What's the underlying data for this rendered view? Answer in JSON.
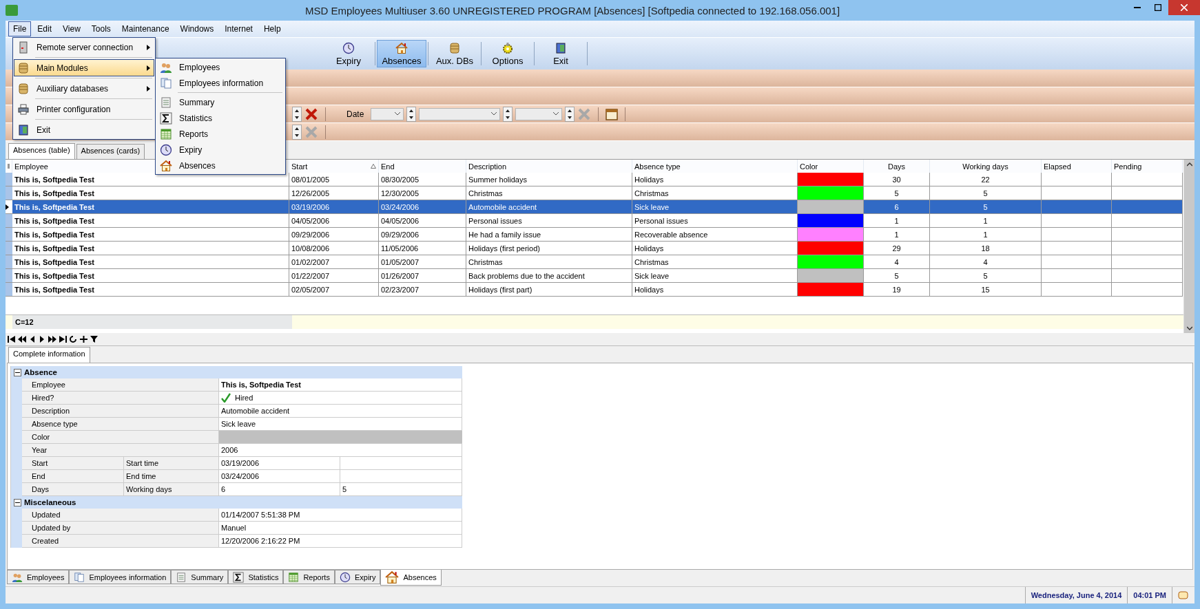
{
  "window": {
    "title": "MSD Employees Multiuser 3.60 UNREGISTERED PROGRAM [Absences] [Softpedia connected to 192.168.056.001]"
  },
  "menu_bar": [
    {
      "label": "File",
      "selected": true
    },
    {
      "label": "Edit",
      "selected": false
    },
    {
      "label": "View",
      "selected": false
    },
    {
      "label": "Tools",
      "selected": false
    },
    {
      "label": "Maintenance",
      "selected": false
    },
    {
      "label": "Windows",
      "selected": false
    },
    {
      "label": "Internet",
      "selected": false
    },
    {
      "label": "Help",
      "selected": false
    }
  ],
  "file_menu": [
    {
      "label": "Remote server connection",
      "has_submenu": true,
      "selected": false
    },
    {
      "label": "Main Modules",
      "has_submenu": true,
      "selected": true
    },
    {
      "label": "Auxiliary databases",
      "has_submenu": true,
      "selected": false
    },
    {
      "label": "Printer configuration",
      "has_submenu": false,
      "selected": false
    },
    {
      "label": "Exit",
      "has_submenu": false,
      "selected": false
    }
  ],
  "submenu": [
    {
      "label": "Employees",
      "separator_after": false
    },
    {
      "label": "Employees information",
      "separator_after": true
    },
    {
      "label": "Summary",
      "separator_after": false
    },
    {
      "label": "Statistics",
      "separator_after": false
    },
    {
      "label": "Reports",
      "separator_after": false
    },
    {
      "label": "Expiry",
      "separator_after": false
    },
    {
      "label": "Absences",
      "separator_after": false
    }
  ],
  "toolbar": [
    {
      "label": "Expiry",
      "selected": false
    },
    {
      "label": "Absences",
      "selected": true
    },
    {
      "label": "Aux. DBs",
      "selected": false
    },
    {
      "label": "Options",
      "selected": false
    },
    {
      "label": "Exit",
      "selected": false
    }
  ],
  "filters": {
    "date_label": "Date"
  },
  "view_tabs": [
    {
      "label": "Absences (table)",
      "selected": true
    },
    {
      "label": "Absences (cards)",
      "selected": false
    }
  ],
  "table": {
    "columns": [
      {
        "label": "Employee",
        "sorted": false
      },
      {
        "label": "Start",
        "sorted": true
      },
      {
        "label": "End",
        "sorted": false
      },
      {
        "label": "Description",
        "sorted": false
      },
      {
        "label": "Absence type",
        "sorted": false
      },
      {
        "label": "Color",
        "sorted": false
      },
      {
        "label": "Days",
        "sorted": false
      },
      {
        "label": "Working days",
        "sorted": false
      },
      {
        "label": "Elapsed",
        "sorted": false
      },
      {
        "label": "Pending",
        "sorted": false
      }
    ],
    "rows": [
      {
        "employee": "This is, Softpedia Test",
        "start": "08/01/2005",
        "end": "08/30/2005",
        "description": "Summer holidays",
        "absence_type": "Holidays",
        "color": "#ff0000",
        "days": "30",
        "working_days": "22",
        "selected": false
      },
      {
        "employee": "This is, Softpedia Test",
        "start": "12/26/2005",
        "end": "12/30/2005",
        "description": "Christmas",
        "absence_type": "Christmas",
        "color": "#00ff00",
        "days": "5",
        "working_days": "5",
        "selected": false
      },
      {
        "employee": "This is, Softpedia Test",
        "start": "03/19/2006",
        "end": "03/24/2006",
        "description": "Automobile accident",
        "absence_type": "Sick leave",
        "color": "#c0c0c0",
        "days": "6",
        "working_days": "5",
        "selected": true
      },
      {
        "employee": "This is, Softpedia Test",
        "start": "04/05/2006",
        "end": "04/05/2006",
        "description": "Personal issues",
        "absence_type": "Personal issues",
        "color": "#0000ff",
        "days": "1",
        "working_days": "1",
        "selected": false
      },
      {
        "employee": "This is, Softpedia Test",
        "start": "09/29/2006",
        "end": "09/29/2006",
        "description": "He had a family issue",
        "absence_type": "Recoverable absence",
        "color": "#ff80ff",
        "days": "1",
        "working_days": "1",
        "selected": false
      },
      {
        "employee": "This is, Softpedia Test",
        "start": "10/08/2006",
        "end": "11/05/2006",
        "description": "Holidays (first period)",
        "absence_type": "Holidays",
        "color": "#ff0000",
        "days": "29",
        "working_days": "18",
        "selected": false
      },
      {
        "employee": "This is, Softpedia Test",
        "start": "01/02/2007",
        "end": "01/05/2007",
        "description": "Christmas",
        "absence_type": "Christmas",
        "color": "#00ff00",
        "days": "4",
        "working_days": "4",
        "selected": false
      },
      {
        "employee": "This is, Softpedia Test",
        "start": "01/22/2007",
        "end": "01/26/2007",
        "description": "Back problems due to the accident",
        "absence_type": "Sick leave",
        "color": "#c0c0c0",
        "days": "5",
        "working_days": "5",
        "selected": false
      },
      {
        "employee": "This is, Softpedia Test",
        "start": "02/05/2007",
        "end": "02/23/2007",
        "description": "Holidays (first part)",
        "absence_type": "Holidays",
        "color": "#ff0000",
        "days": "19",
        "working_days": "15",
        "selected": false
      }
    ],
    "footer": "C=12"
  },
  "detail_tabs": [
    {
      "label": "Complete information",
      "selected": true
    }
  ],
  "details": [
    {
      "title": "Absence",
      "expanded": true,
      "rows": [
        {
          "kind": "bold",
          "label": "Employee",
          "value": "This is, Softpedia Test"
        },
        {
          "kind": "check",
          "label": "Hired?",
          "value": "Hired",
          "checked": true
        },
        {
          "kind": "text",
          "label": "Description",
          "value": "Automobile accident"
        },
        {
          "kind": "text",
          "label": "Absence type",
          "value": "Sick leave"
        },
        {
          "kind": "color",
          "label": "Color",
          "color": "#c0c0c0"
        },
        {
          "kind": "text",
          "label": "Year",
          "value": "2006"
        },
        {
          "kind": "split",
          "label": "Start",
          "sublabel": "Start time",
          "value": "03/19/2006"
        },
        {
          "kind": "split",
          "label": "End",
          "sublabel": "End time",
          "value": "03/24/2006"
        },
        {
          "kind": "split",
          "label": "Days",
          "sublabel": "Working days",
          "value": "6",
          "value2": "5"
        }
      ]
    },
    {
      "title": "Miscelaneous",
      "expanded": true,
      "rows": [
        {
          "kind": "text",
          "label": "Updated",
          "value": "01/14/2007 5:51:38 PM"
        },
        {
          "kind": "text",
          "label": "Updated by",
          "value": "Manuel"
        },
        {
          "kind": "text",
          "label": "Created",
          "value": "12/20/2006 2:16:22 PM"
        }
      ]
    }
  ],
  "module_tabs": [
    {
      "label": "Employees",
      "selected": false
    },
    {
      "label": "Employees information",
      "selected": false
    },
    {
      "label": "Summary",
      "selected": false
    },
    {
      "label": "Statistics",
      "selected": false
    },
    {
      "label": "Reports",
      "selected": false
    },
    {
      "label": "Expiry",
      "selected": false
    },
    {
      "label": "Absences",
      "selected": true
    }
  ],
  "status_bar": {
    "date": "Wednesday, June 4, 2014",
    "time": "04:01 PM"
  }
}
